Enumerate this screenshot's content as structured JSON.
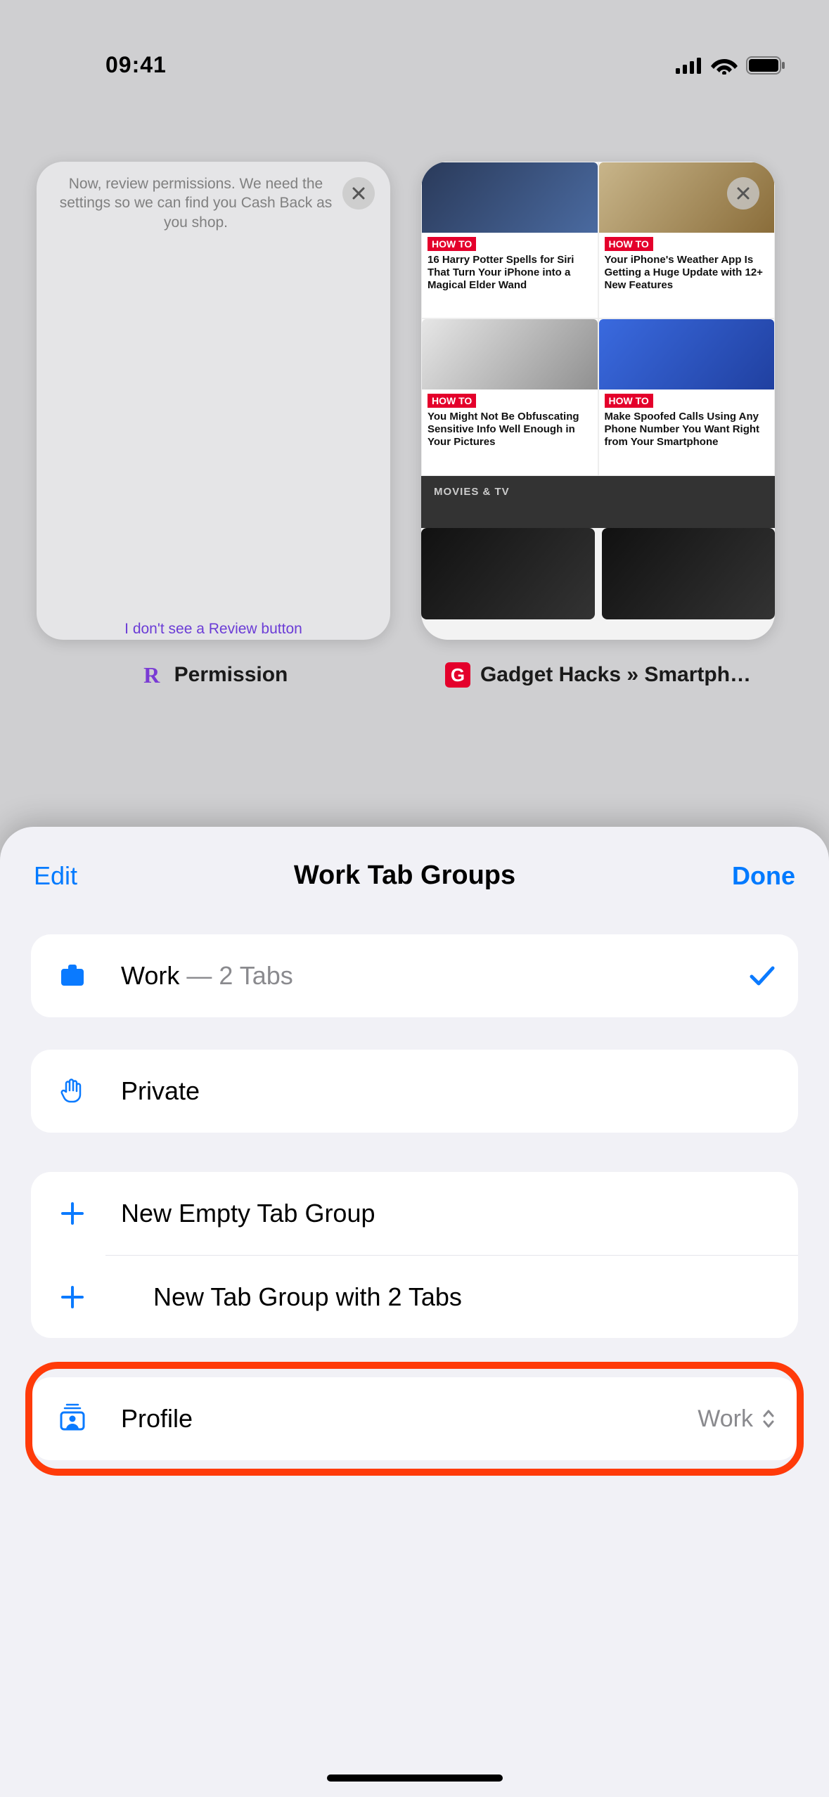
{
  "status": {
    "time": "09:41"
  },
  "tabs": [
    {
      "favicon": "R",
      "title": "Permission",
      "body_text": "Now, review permissions. We need the settings so we can find you Cash Back as you shop.",
      "footer_text": "I don't see a Review button"
    },
    {
      "favicon": "G",
      "title": "Gadget Hacks » Smartph…",
      "cells": [
        {
          "tag": "HOW TO",
          "text": "16 Harry Potter Spells for Siri That Turn Your iPhone into a Magical Elder Wand"
        },
        {
          "tag": "HOW TO",
          "text": "Your iPhone's Weather App Is Getting a Huge Update with 12+ New Features"
        },
        {
          "tag": "HOW TO",
          "text": "You Might Not Be Obfuscating Sensitive Info Well Enough in Your Pictures"
        },
        {
          "tag": "HOW TO",
          "text": "Make Spoofed Calls Using Any Phone Number You Want Right from Your Smartphone"
        }
      ],
      "section": "MOVIES & TV"
    }
  ],
  "sheet": {
    "edit": "Edit",
    "title": "Work Tab Groups",
    "done": "Done",
    "work": {
      "label": "Work",
      "sub": "— 2 Tabs"
    },
    "private": {
      "label": "Private"
    },
    "new_empty": "New Empty Tab Group",
    "new_with": "New Tab Group with 2 Tabs",
    "profile": {
      "label": "Profile",
      "value": "Work"
    }
  }
}
